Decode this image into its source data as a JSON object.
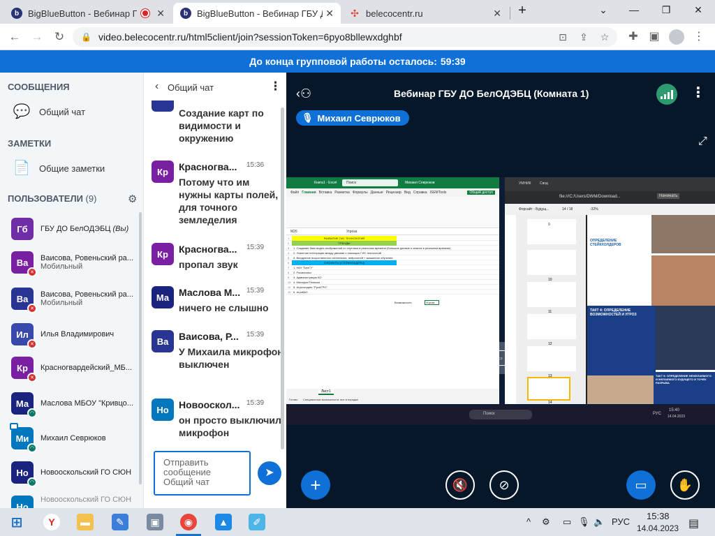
{
  "browser": {
    "tabs": [
      {
        "title": "BigBlueButton - Вебинар ГБ",
        "favicon": "bbb-icon",
        "recording": true
      },
      {
        "title": "BigBlueButton - Вебинар ГБУ Д",
        "favicon": "bbb-icon",
        "active": true
      },
      {
        "title": "belecocentr.ru",
        "favicon": "belecocentr-icon"
      }
    ],
    "url": "video.belecocentr.ru/html5client/join?sessionToken=6pyo8bllewxdghbf",
    "new_tab_glyph": "+"
  },
  "banner": {
    "text": "До конца групповой работы осталось:",
    "time": "59:39"
  },
  "left": {
    "messages_header": "СООБЩЕНИЯ",
    "public_chat": "Общий чат",
    "notes_header": "ЗАМЕТКИ",
    "shared_notes": "Общие заметки",
    "users_header": "ПОЛЬЗОВАТЕЛИ",
    "users_count": "(9)",
    "users": [
      {
        "initials": "Гб",
        "name": "ГБУ ДО БелОДЭБЦ",
        "suffix": "(Вы)",
        "color": "#6f2da8",
        "status": ""
      },
      {
        "initials": "Ва",
        "name": "Ваисова, Ровеньский ра...",
        "sub": "Мобильный",
        "color": "#7b1fa2",
        "status": "muted"
      },
      {
        "initials": "Ва",
        "name": "Ваисова, Ровеньский ра...",
        "sub": "Мобильный",
        "color": "#283593",
        "status": "muted"
      },
      {
        "initials": "Ил",
        "name": "Илья Владимирович",
        "color": "#3949ab",
        "status": "muted"
      },
      {
        "initials": "Кр",
        "name": "Красногвардейский_МБ...",
        "color": "#7b1fa2",
        "status": "muted"
      },
      {
        "initials": "Ма",
        "name": "Маслова МБОУ \"Кривцо...",
        "color": "#1a237e",
        "status": "listen"
      },
      {
        "initials": "Ми",
        "name": "Михаил Севрюков",
        "color": "#0277bd",
        "status": "listen"
      },
      {
        "initials": "Но",
        "name": "Новооскольский ГО СЮН",
        "color": "#1a237e",
        "status": "listen"
      },
      {
        "initials": "Но",
        "name": "Новооскольский ГО СЮН",
        "color": "#0277bd",
        "status": ""
      }
    ]
  },
  "chat": {
    "title": "Общий чат",
    "first_text": "Создание карт по видимости и окружению",
    "messages": [
      {
        "initials": "Кр",
        "name": "Красногва...",
        "time": "15:36",
        "text": "Потому что им нужны карты полей, для точного земледелия",
        "color": "#7b1fa2"
      },
      {
        "initials": "Кр",
        "name": "Красногва...",
        "time": "15:39",
        "text": "пропал звук",
        "color": "#7b1fa2"
      },
      {
        "initials": "Ма",
        "name": "Маслова М...",
        "time": "15:39",
        "text": "ничего не слышно",
        "color": "#1a237e"
      },
      {
        "initials": "Ва",
        "name": "Ваисова, Р...",
        "time": "15:39",
        "text": "У Михаила микрофон выключен",
        "color": "#283593"
      },
      {
        "initials": "Но",
        "name": "Новооскол...",
        "time": "15:39",
        "text": "он просто выключил микрофон",
        "color": "#0277bd"
      }
    ],
    "input_placeholder": "Отправить сообщение Общий чат"
  },
  "stage": {
    "title": "Вебинар ГБУ ДО БелОДЭБЦ (Комната 1)",
    "presenter": "Михаил Севрюков"
  },
  "share": {
    "excel_title": "Книга1 - Excel",
    "excel_search": "Поиск",
    "excel_user": "Михаил Севрюков",
    "excel_tabs": [
      "Файл",
      "Главная",
      "Вставка",
      "Разметка",
      "Формулы",
      "Данные",
      "Рецензир",
      "Вид",
      "Справка",
      "ISEMTools"
    ],
    "excel_share": "Общий доступ",
    "cell_ref": "M26",
    "cell_value": "Угроза",
    "rows": [
      {
        "n": "1",
        "text": "РАЗВИТИЕ ГИС ТЕХНОЛОГИЙ",
        "fill": "#ffff00"
      },
      {
        "n": "2",
        "text": "ТРЕНДЫ",
        "fill": "#92d050"
      },
      {
        "n": "3",
        "text": "1. Создание банк видео-изображений со спутника в реальном времени (большие данные и анализ в реальном времени)",
        "fill": ""
      },
      {
        "n": "4",
        "text": "2. Усиление интеграции между умными с помощью ГИС технологий",
        "fill": ""
      },
      {
        "n": "5",
        "text": "3. Внедрение искусственного интеллекта, нейросетей + машинное обучение",
        "fill": ""
      },
      {
        "n": "6",
        "text": "СУБЪЕКТЫ (СТЕЙКХОЛДЕРЫ)",
        "fill": "#00b0f0"
      },
      {
        "n": "7",
        "text": "1. НИУ \"БелГУ\"",
        "fill": ""
      },
      {
        "n": "8",
        "text": "2. Росакосмос",
        "fill": ""
      },
      {
        "n": "9",
        "text": "3. Администрация БО",
        "fill": ""
      },
      {
        "n": "10",
        "text": "4. Мегафон/Телеком",
        "fill": ""
      },
      {
        "n": "11",
        "text": "5. Агрохолдинг \"РусАГРО\"",
        "fill": ""
      },
      {
        "n": "12",
        "text": "6. АгроВАЗ",
        "fill": ""
      }
    ],
    "opportunity": "Возможность",
    "threat": "Угроза",
    "sheet": "Лист1",
    "status_ready": "Готово",
    "status_access": "Специальные возможности: все в порядке",
    "pdf_tab": "Форсайт - Будущ...",
    "pdf_url": "file:///C:/Users/DWM/Download...",
    "pdf_page": "14 / 18",
    "pdf_zoom": "-32%",
    "pdf_bookmark": "Начинать",
    "slide_heading_1": "ОПРЕДЕЛЕНИЕ СТЕЙКХОЛДЕРОВ",
    "slide_heading_2": "ТАКТ 4: ОПРЕДЕЛЕНИЕ ВОЗМОЖНОСТЕЙ И УГРОЗ",
    "slide_heading_3": "ТАКТ 5: ОПРЕДЕЛЕНИЕ НЕЖЕЛАЕМОГО И ЖЕЛАЕМОГО БУДУЩЕГО И ТОЧЕК РАЗРЫВА",
    "thumbs": [
      "9",
      "10",
      "11",
      "12",
      "13",
      "14"
    ],
    "share_search": "Поиск",
    "share_lang": "РУС",
    "share_time": "15:40",
    "share_date": "14.04.2023",
    "share_tab_2": "УМНИК",
    "share_tab_3": "Свод"
  },
  "taskbar": {
    "lang": "РУС",
    "time": "15:38",
    "date": "14.04.2023"
  }
}
